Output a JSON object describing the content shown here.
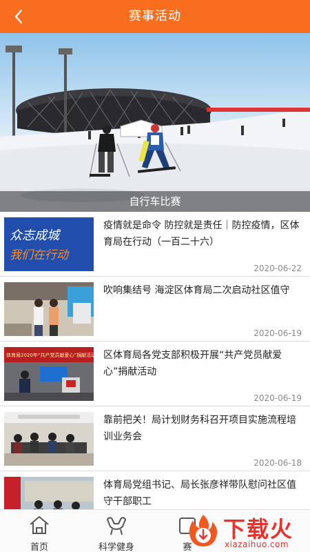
{
  "header": {
    "title": "赛事活动"
  },
  "banner": {
    "caption": "自行车比赛"
  },
  "news": [
    {
      "title": "疫情就是命令 防控就是责任｜防控疫情，区体育局在行动（一百二十六）",
      "date": "2020-06-22",
      "thumb_text": [
        "众志成城",
        "我们在行动"
      ]
    },
    {
      "title": "吹响集结号 海淀区体育局二次启动社区值守",
      "date": "2020-06-19"
    },
    {
      "title": "区体育局各党支部积极开展“共产党员献爱心”捐献活动",
      "date": "2020-06-19",
      "thumb_text": [
        "体育局2020年“共产党员献爱心”捐献活动"
      ]
    },
    {
      "title": "靠前把关！局计划财务科召开项目实施流程培训业务会",
      "date": "2020-06-18"
    },
    {
      "title": "体育局党组书记、局长张彦祥带队慰问社区值守干部职工",
      "date": ""
    }
  ],
  "nav": [
    {
      "label": "首页",
      "icon": "home-icon"
    },
    {
      "label": "科学健身",
      "icon": "fitness-icon"
    },
    {
      "label": "赛",
      "icon": "event-icon"
    }
  ],
  "watermark": {
    "text": "下载火",
    "url": "xiazaihuo.com"
  }
}
